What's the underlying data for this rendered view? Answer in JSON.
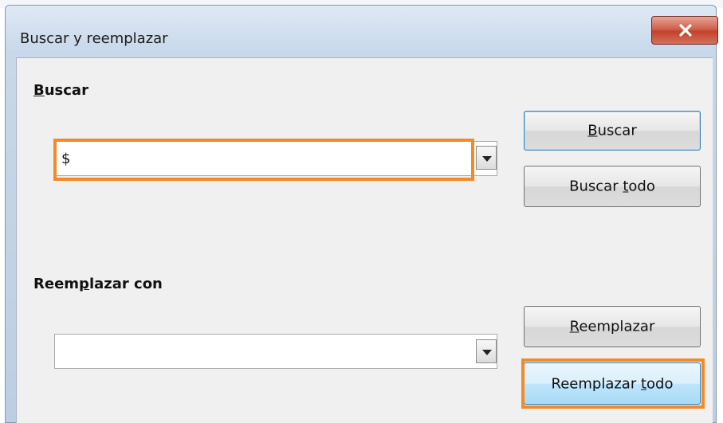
{
  "window": {
    "title": "Buscar y reemplazar"
  },
  "find": {
    "label_u": "B",
    "label_rest": "uscar",
    "value": "$"
  },
  "replace": {
    "label_pre": "Reem",
    "label_u": "p",
    "label_rest": "lazar con",
    "value": ""
  },
  "buttons": {
    "find_u": "B",
    "find_rest": "uscar",
    "find_all_pre": "Buscar ",
    "find_all_u": "t",
    "find_all_rest": "odo",
    "replace_u": "R",
    "replace_rest": "eemplazar",
    "replace_all_pre": "Reemplazar ",
    "replace_all_u": "t",
    "replace_all_rest": "odo"
  },
  "colors": {
    "highlight": "#f28a2a",
    "title_bar": "#c8d8ea",
    "close_button": "#c2422b"
  },
  "icons": {
    "close": "close-icon",
    "dropdown": "chevron-down-icon"
  }
}
